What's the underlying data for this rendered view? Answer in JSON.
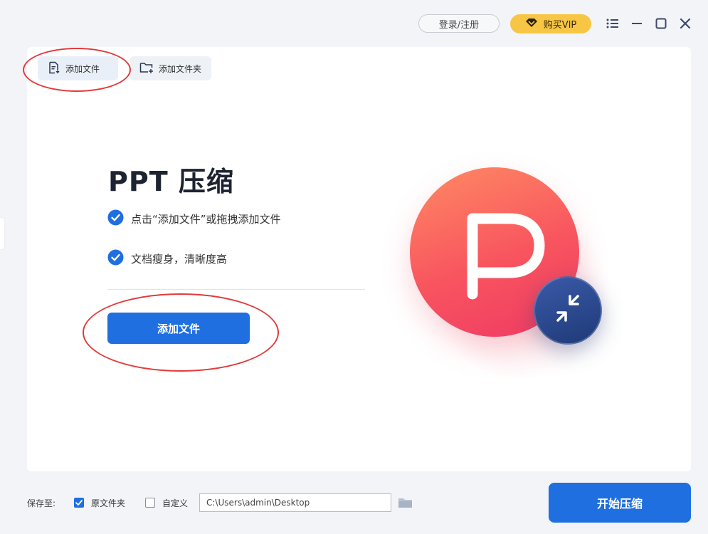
{
  "header": {
    "login_label": "登录/注册",
    "vip_label": "购买VIP",
    "controls": [
      "list-icon",
      "minimize-icon",
      "maximize-icon",
      "close-icon"
    ]
  },
  "tabs": {
    "add_file": "添加文件",
    "add_folder": "添加文件夹"
  },
  "main": {
    "title": "PPT 压缩",
    "features": [
      "点击“添加文件”或拖拽添加文件",
      "文档瘦身，清晰度高"
    ],
    "add_button": "添加文件"
  },
  "bottom": {
    "save_label": "保存至:",
    "option_original": "原文件夹",
    "option_custom": "自定义",
    "original_checked": true,
    "custom_checked": false,
    "path_value": "C:\\Users\\admin\\Desktop",
    "start_button": "开始压缩"
  },
  "colors": {
    "accent": "#1f6fe0",
    "vip": "#f7c645",
    "annotation": "#e23a3a"
  }
}
